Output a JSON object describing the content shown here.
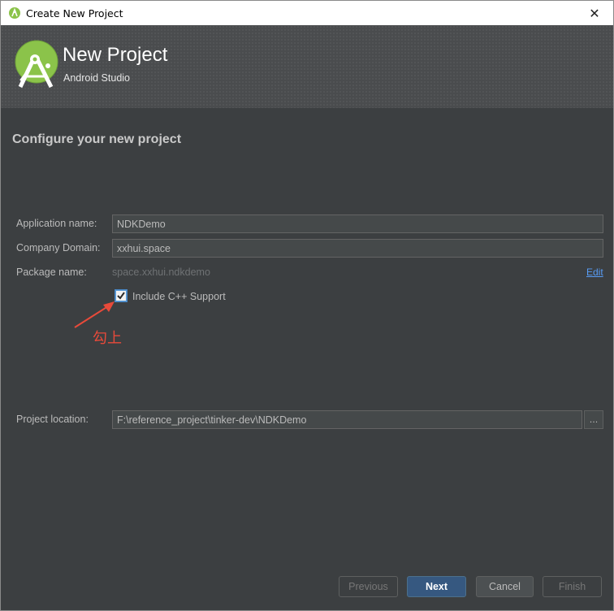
{
  "window": {
    "title": "Create New Project",
    "close_glyph": "✕"
  },
  "header": {
    "title": "New Project",
    "subtitle": "Android Studio"
  },
  "page": {
    "subtitle": "Configure your new project"
  },
  "form": {
    "app_name": {
      "label": "Application name:",
      "value": "NDKDemo"
    },
    "company_domain": {
      "label": "Company Domain:",
      "value": "xxhui.space"
    },
    "package_name": {
      "label": "Package name:",
      "value": "space.xxhui.ndkdemo",
      "edit_label": "Edit"
    },
    "cpp_support": {
      "label": "Include C++ Support",
      "checked": true
    },
    "project_location": {
      "label": "Project location:",
      "value": "F:\\reference_project\\tinker-dev\\NDKDemo",
      "browse_label": "..."
    }
  },
  "annotation": {
    "text": "勾上",
    "color": "#e84a3a"
  },
  "buttons": {
    "previous": "Previous",
    "next": "Next",
    "cancel": "Cancel",
    "finish": "Finish"
  },
  "colors": {
    "accent": "#365880",
    "link": "#589df6",
    "background": "#3c3f41",
    "android_green": "#8bc34a"
  }
}
